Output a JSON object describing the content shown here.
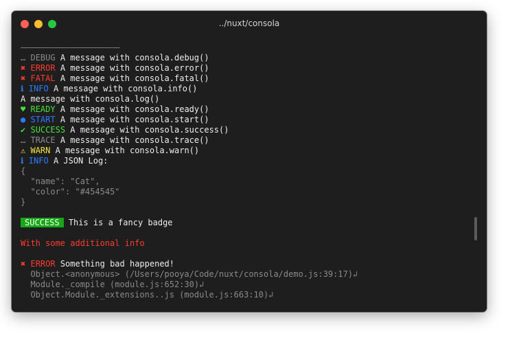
{
  "window": {
    "title": "../nuxt/consola"
  },
  "colors": {
    "debug": "#8a8a8a",
    "error": "#ff3b30",
    "info": "#2f7bff",
    "success": "#47e03a",
    "warn": "#f4e542",
    "badge_bg": "#17a717"
  },
  "log": {
    "separator": "————————————————————",
    "debug": {
      "icon": "…",
      "tag": "DEBUG",
      "msg": "A message with consola.debug()"
    },
    "error": {
      "icon": "✖",
      "tag": "ERROR",
      "msg": "A message with consola.error()"
    },
    "fatal": {
      "icon": "✖",
      "tag": "FATAL",
      "msg": "A message with consola.fatal()"
    },
    "info": {
      "icon": "ℹ",
      "tag": "INFO",
      "msg": "A message with consola.info()"
    },
    "log": {
      "msg": "A message with consola.log()"
    },
    "ready": {
      "icon": "♥",
      "tag": "READY",
      "msg": "A message with consola.ready()"
    },
    "start": {
      "icon": "●",
      "tag": "START",
      "msg": "A message with consola.start()"
    },
    "success": {
      "icon": "✔",
      "tag": "SUCCESS",
      "msg": "A message with consola.success()"
    },
    "trace": {
      "icon": "…",
      "tag": "TRACE",
      "msg": "A message with consola.trace()"
    },
    "warn": {
      "icon": "⚠",
      "tag": "WARN",
      "msg": "A message with consola.warn()"
    },
    "json": {
      "icon": "ℹ",
      "tag": "INFO",
      "msg": "A JSON Log:",
      "open": "{",
      "line1": "  \"name\": \"Cat\",",
      "line2": "  \"color\": \"#454545\"",
      "close": "}"
    },
    "badge": {
      "tag": "SUCCESS",
      "msg": "This is a fancy badge"
    },
    "additional": "With some additional info",
    "error_block": {
      "icon": "✖",
      "tag": "ERROR",
      "msg": "Something bad happened!",
      "stack": [
        "  Object.<anonymous> (/Users/pooya/Code/nuxt/consola/demo.js:39:17)↲",
        "  Module._compile (module.js:652:30)↲",
        "  Object.Module._extensions..js (module.js:663:10)↲"
      ]
    }
  }
}
